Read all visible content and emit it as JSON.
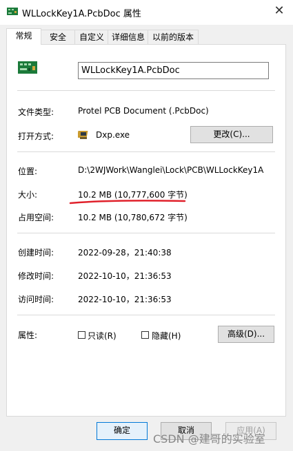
{
  "window": {
    "title": "WLLockKey1A.PcbDoc 属性",
    "close_label": "✕"
  },
  "tabs": [
    {
      "label": "常规",
      "active": true
    },
    {
      "label": "安全"
    },
    {
      "label": "自定义"
    },
    {
      "label": "详细信息"
    },
    {
      "label": "以前的版本"
    }
  ],
  "general": {
    "file_name": "WLLockKey1A.PcbDoc",
    "file_type_label": "文件类型:",
    "file_type_value": "Protel PCB Document (.PcbDoc)",
    "open_with_label": "打开方式:",
    "open_with_value": "Dxp.exe",
    "change_button": "更改(C)...",
    "location_label": "位置:",
    "location_value": "D:\\2WJWork\\Wanglei\\Lock\\PCB\\WLLockKey1A",
    "size_label": "大小:",
    "size_value": "10.2 MB (10,777,600 字节)",
    "disk_size_label": "占用空间:",
    "disk_size_value": "10.2 MB (10,780,672 字节)",
    "created_label": "创建时间:",
    "created_value": "2022-09-28，21:40:38",
    "modified_label": "修改时间:",
    "modified_value": "2022-10-10，21:36:53",
    "accessed_label": "访问时间:",
    "accessed_value": "2022-10-10，21:36:53",
    "attributes_label": "属性:",
    "readonly_label": "只读(R)",
    "hidden_label": "隐藏(H)",
    "advanced_button": "高级(D)...",
    "readonly_checked": false,
    "hidden_checked": false
  },
  "footer": {
    "ok": "确定",
    "cancel": "取消",
    "apply": "应用(A)"
  },
  "watermark": "CSDN @建哥的实验室",
  "icons": {
    "title": "pcb-document-icon",
    "file": "pcb-document-icon",
    "program": "dxp-program-icon"
  },
  "colors": {
    "annotation_line": "#e0202a",
    "primary_border": "#0078d7"
  }
}
